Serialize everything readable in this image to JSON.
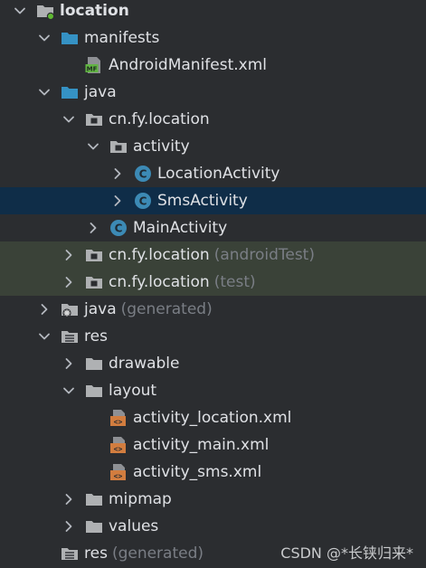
{
  "tree": {
    "nodes": [
      {
        "label": "location",
        "suffix": "",
        "indent": 0,
        "chevron": "down",
        "icon": "project-folder-icon",
        "state": "root"
      },
      {
        "label": "manifests",
        "suffix": "",
        "indent": 1,
        "chevron": "down",
        "icon": "folder-blue-icon",
        "state": ""
      },
      {
        "label": "AndroidManifest.xml",
        "suffix": "",
        "indent": 2,
        "chevron": "none",
        "icon": "manifest-file-icon",
        "state": ""
      },
      {
        "label": "java",
        "suffix": "",
        "indent": 1,
        "chevron": "down",
        "icon": "folder-blue-icon",
        "state": ""
      },
      {
        "label": "cn.fy.location",
        "suffix": "",
        "indent": 2,
        "chevron": "down",
        "icon": "package-icon",
        "state": ""
      },
      {
        "label": "activity",
        "suffix": "",
        "indent": 3,
        "chevron": "down",
        "icon": "package-icon",
        "state": ""
      },
      {
        "label": "LocationActivity",
        "suffix": "",
        "indent": 4,
        "chevron": "right",
        "icon": "class-icon",
        "state": ""
      },
      {
        "label": "SmsActivity",
        "suffix": "",
        "indent": 4,
        "chevron": "right",
        "icon": "class-icon",
        "state": "selected"
      },
      {
        "label": "MainActivity",
        "suffix": "",
        "indent": 3,
        "chevron": "right",
        "icon": "class-icon",
        "state": ""
      },
      {
        "label": "cn.fy.location",
        "suffix": "(androidTest)",
        "indent": 2,
        "chevron": "right",
        "icon": "package-icon",
        "state": "testsrc"
      },
      {
        "label": "cn.fy.location",
        "suffix": "(test)",
        "indent": 2,
        "chevron": "right",
        "icon": "package-icon",
        "state": "testsrc"
      },
      {
        "label": "java",
        "suffix": "(generated)",
        "indent": 1,
        "chevron": "right",
        "icon": "generated-folder-icon",
        "state": ""
      },
      {
        "label": "res",
        "suffix": "",
        "indent": 1,
        "chevron": "down",
        "icon": "resource-folder-icon",
        "state": ""
      },
      {
        "label": "drawable",
        "suffix": "",
        "indent": 2,
        "chevron": "right",
        "icon": "folder-gray-icon",
        "state": ""
      },
      {
        "label": "layout",
        "suffix": "",
        "indent": 2,
        "chevron": "down",
        "icon": "folder-gray-icon",
        "state": ""
      },
      {
        "label": "activity_location.xml",
        "suffix": "",
        "indent": 3,
        "chevron": "none",
        "icon": "layout-xml-icon",
        "state": ""
      },
      {
        "label": "activity_main.xml",
        "suffix": "",
        "indent": 3,
        "chevron": "none",
        "icon": "layout-xml-icon",
        "state": ""
      },
      {
        "label": "activity_sms.xml",
        "suffix": "",
        "indent": 3,
        "chevron": "none",
        "icon": "layout-xml-icon",
        "state": ""
      },
      {
        "label": "mipmap",
        "suffix": "",
        "indent": 2,
        "chevron": "right",
        "icon": "folder-gray-icon",
        "state": ""
      },
      {
        "label": "values",
        "suffix": "",
        "indent": 2,
        "chevron": "right",
        "icon": "folder-gray-icon",
        "state": ""
      },
      {
        "label": "res",
        "suffix": "(generated)",
        "indent": 1,
        "chevron": "none",
        "icon": "resource-folder-icon",
        "state": ""
      }
    ]
  },
  "watermark": "CSDN @*长铗归来*",
  "colors": {
    "background": "#2b2d30",
    "selected_row": "#0f2d48",
    "test_source_row": "#3a4238",
    "folder_blue": "#3592c4",
    "folder_gray": "#afb1b3",
    "class_icon": "#3c8ab5",
    "xml_icon": "#d27d3f",
    "manifest_icon": "#62b543"
  }
}
